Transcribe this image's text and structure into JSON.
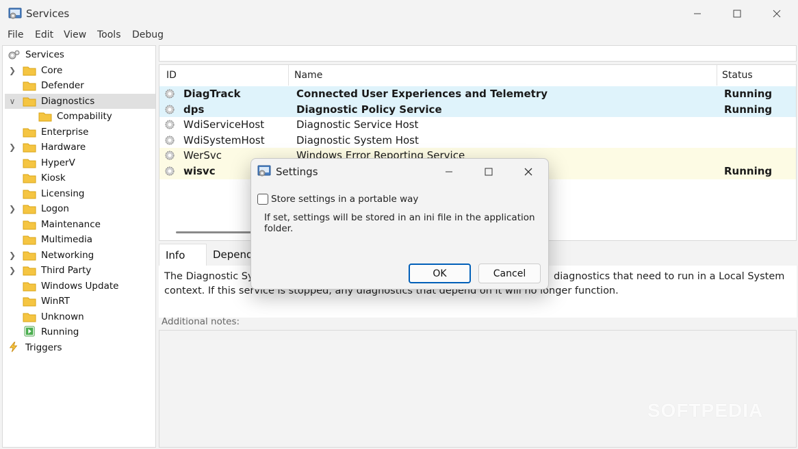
{
  "window": {
    "title": "Services",
    "controls": {
      "minimize": "—",
      "maximize": "☐",
      "close": "✕"
    }
  },
  "menu": [
    "File",
    "Edit",
    "View",
    "Tools",
    "Debug"
  ],
  "tree": {
    "root": "Services",
    "items": [
      {
        "label": "Core",
        "expandable": true,
        "expanded": false
      },
      {
        "label": "Defender",
        "expandable": false
      },
      {
        "label": "Diagnostics",
        "expandable": true,
        "expanded": true,
        "selected": true
      },
      {
        "label": "Compability",
        "child": true
      },
      {
        "label": "Enterprise",
        "expandable": false
      },
      {
        "label": "Hardware",
        "expandable": true,
        "expanded": false
      },
      {
        "label": "HyperV",
        "expandable": false
      },
      {
        "label": "Kiosk",
        "expandable": false
      },
      {
        "label": "Licensing",
        "expandable": false
      },
      {
        "label": "Logon",
        "expandable": true,
        "expanded": false
      },
      {
        "label": "Maintenance",
        "expandable": false
      },
      {
        "label": "Multimedia",
        "expandable": false
      },
      {
        "label": "Networking",
        "expandable": true,
        "expanded": false
      },
      {
        "label": "Third Party",
        "expandable": true,
        "expanded": false
      },
      {
        "label": "Windows Update",
        "expandable": false
      },
      {
        "label": "WinRT",
        "expandable": false
      },
      {
        "label": "Unknown",
        "expandable": false
      },
      {
        "label": "Running",
        "icon": "running-icon"
      }
    ],
    "triggers": "Triggers"
  },
  "list": {
    "columns": [
      "ID",
      "Name",
      "Status"
    ],
    "rows": [
      {
        "id": "DiagTrack",
        "name": "Connected User Experiences and Telemetry",
        "status": "Running",
        "style": "running"
      },
      {
        "id": "dps",
        "name": "Diagnostic Policy Service",
        "status": "Running",
        "style": "running"
      },
      {
        "id": "WdiServiceHost",
        "name": "Diagnostic Service Host",
        "status": "",
        "style": "normal"
      },
      {
        "id": "WdiSystemHost",
        "name": "Diagnostic System Host",
        "status": "",
        "style": "normal"
      },
      {
        "id": "WerSvc",
        "name": "Windows Error Reporting Service",
        "status": "",
        "style": "yellow"
      },
      {
        "id": "wisvc",
        "name": "",
        "status": "Running",
        "style": "yellow-bold"
      }
    ]
  },
  "tabs": [
    "Info",
    "Depend"
  ],
  "info": {
    "line1_left": "The Diagnostic Sy",
    "line1_right": "diagnostics that need to run in a Local System",
    "line2": "context.  If this service is stopped, any diagnostics that depend on it will no longer function."
  },
  "notes_label": "Additional notes:",
  "dialog": {
    "title": "Settings",
    "checkbox_label": "Store settings in a portable way",
    "checked": false,
    "description": "If set, settings will be stored in an ini file in the application folder.",
    "ok": "OK",
    "cancel": "Cancel"
  },
  "watermark": "SOFTPEDIA",
  "colors": {
    "running_row": "#dff3fb",
    "yellow_row": "#fdfbe4",
    "selected_tree": "#e0e0e0",
    "accent": "#005fb8"
  }
}
